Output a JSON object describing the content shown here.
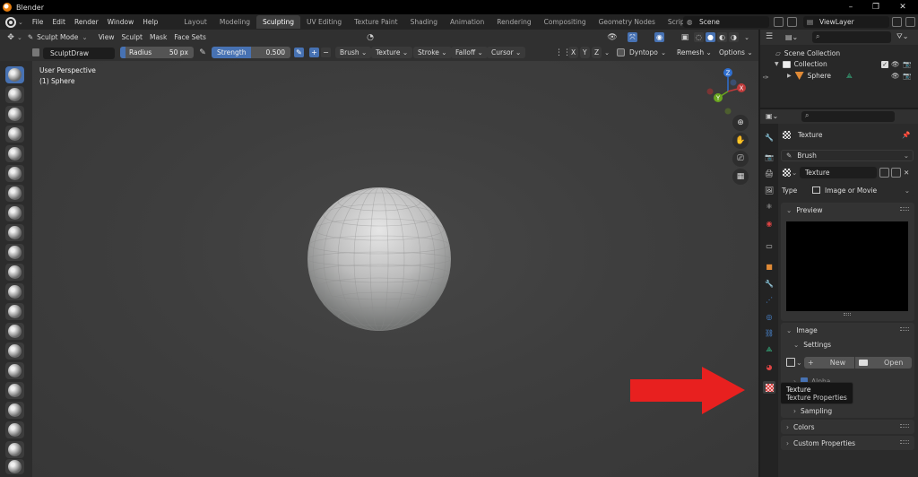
{
  "window": {
    "title": "Blender",
    "controls": [
      "–",
      "❐",
      "✕"
    ]
  },
  "menu": [
    "File",
    "Edit",
    "Render",
    "Window",
    "Help"
  ],
  "workspaces": [
    "Layout",
    "Modeling",
    "Sculpting",
    "UV Editing",
    "Texture Paint",
    "Shading",
    "Animation",
    "Rendering",
    "Compositing",
    "Geometry Nodes",
    "Scripting"
  ],
  "active_workspace": "Sculpting",
  "scene": {
    "label": "Scene"
  },
  "view_layer": {
    "label": "ViewLayer"
  },
  "header": {
    "mode": "Sculpt Mode",
    "menus": [
      "View",
      "Sculpt",
      "Mask",
      "Face Sets"
    ]
  },
  "tool_settings": {
    "brush": "SculptDraw",
    "radius_label": "Radius",
    "radius_value": "50 px",
    "strength_label": "Strength",
    "strength_value": "0.500",
    "plus": "+",
    "minus": "−",
    "dropdowns": [
      "Brush",
      "Texture",
      "Stroke",
      "Falloff",
      "Cursor"
    ],
    "axes": [
      "X",
      "Y",
      "Z"
    ],
    "dyntopo": "Dyntopo",
    "remesh": "Remesh",
    "options": "Options"
  },
  "viewport": {
    "perspective": "User Perspective",
    "object": "(1) Sphere"
  },
  "gizmo": {
    "x": "X",
    "y": "Y",
    "z": "Z"
  },
  "outliner": {
    "scene_collection": "Scene Collection",
    "collection": "Collection",
    "object": "Sphere"
  },
  "properties": {
    "context_title": "Texture",
    "source": "Brush",
    "texture_name": "Texture",
    "type_label": "Type",
    "type_value": "Image or Movie",
    "panels": {
      "preview": "Preview",
      "image": "Image",
      "settings": "Settings",
      "new": "New",
      "open": "Open",
      "alpha": "Alpha",
      "sampling": "Sampling",
      "colors": "Colors",
      "custom_properties": "Custom Properties"
    }
  },
  "tooltip": {
    "title": "Texture",
    "subtitle": "Texture Properties"
  },
  "colors": {
    "accent": "#4772b3",
    "arrow": "#e8201f",
    "active_tab": "#3d3d3d"
  }
}
